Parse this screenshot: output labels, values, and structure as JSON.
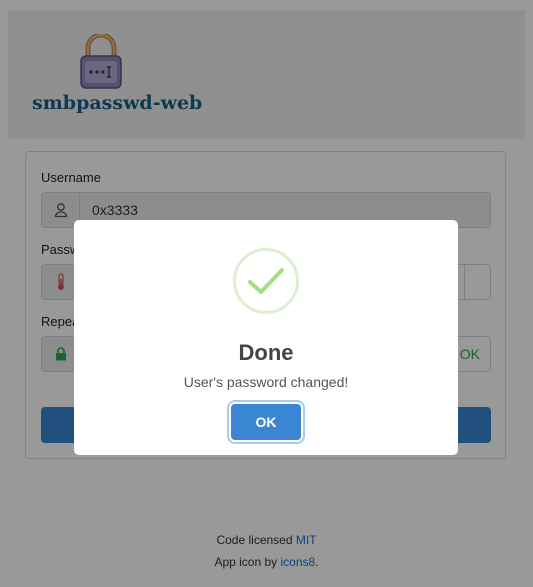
{
  "app": {
    "title": "smbpasswd-web"
  },
  "form": {
    "username_label": "Username",
    "username_value": "0x3333",
    "password_label": "Passw",
    "repeat_label": "Repea",
    "repeat_match_text": "OK"
  },
  "modal": {
    "title": "Done",
    "message": "User's password changed!",
    "ok_label": "OK"
  },
  "footer": {
    "line1_prefix": "Code licensed ",
    "line1_link": "MIT",
    "line2_prefix": "App icon by ",
    "line2_link": "icons8",
    "line2_suffix": "."
  },
  "colors": {
    "accent": "#3a86d3",
    "success": "#28a745",
    "title": "#1b5f88",
    "link": "#1a6fd6"
  }
}
